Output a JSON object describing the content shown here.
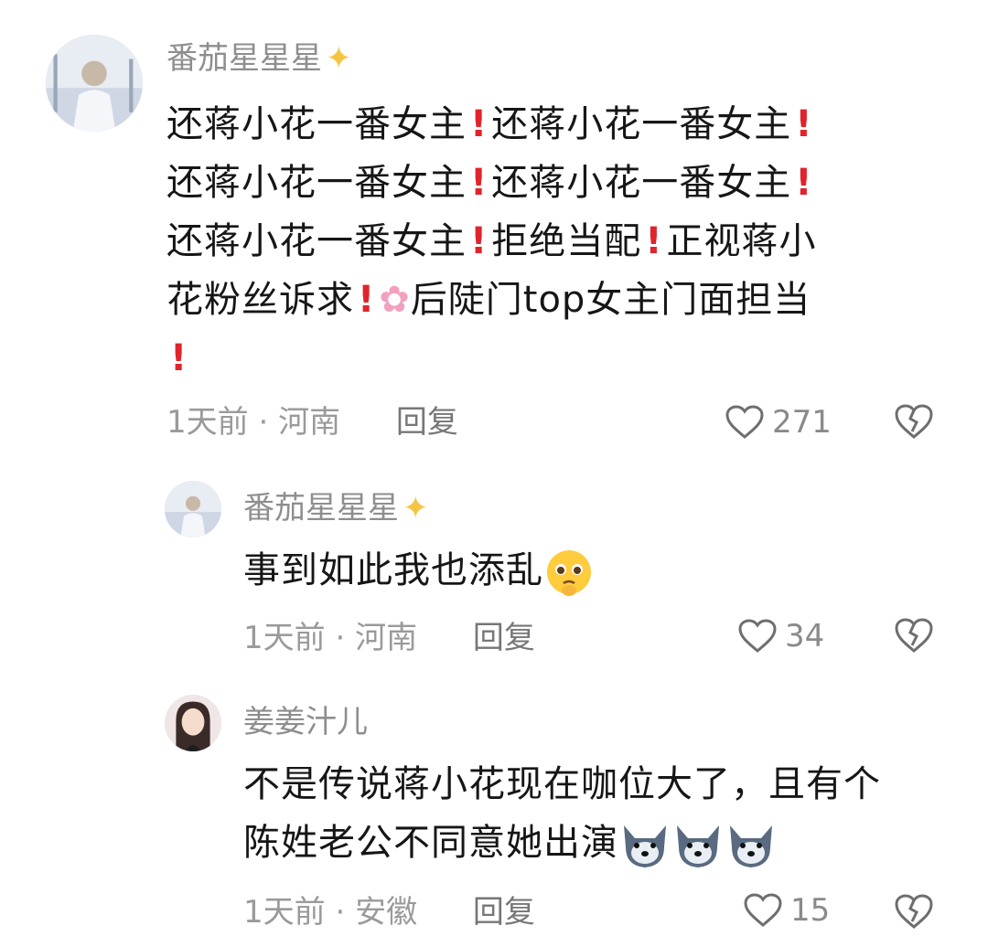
{
  "comments": [
    {
      "user": "番茄星星星",
      "lines": [
        "还蒋小花一番女主",
        "还蒋小花一番女主",
        "还蒋小花一番女主",
        "还蒋小花一番女主",
        "还蒋小花一番女主",
        "拒绝当配",
        "正视蒋小",
        "花粉丝诉求",
        "后陡门top女主门面担当"
      ],
      "time": "1天前",
      "location": "河南",
      "reply_label": "回复",
      "likes": "271"
    },
    {
      "user": "番茄星星星",
      "text": "事到如此我也添乱",
      "time": "1天前",
      "location": "河南",
      "reply_label": "回复",
      "likes": "34"
    },
    {
      "user": "姜姜汁儿",
      "line1": "不是传说蒋小花现在咖位大了，且有个",
      "line2": "陈姓老公不同意她出演",
      "time": "1天前",
      "location": "安徽",
      "reply_label": "回复",
      "likes": "15"
    }
  ],
  "separator": "·",
  "icons": [
    "sparkle-icon",
    "exclamation-icon",
    "cherry-blossom-icon",
    "pleading-face-icon",
    "husky-face-icon",
    "heart-icon",
    "broken-heart-icon"
  ],
  "colors": {
    "exclamation": "#e0242b",
    "muted": "#8e8e8e",
    "text": "#161616"
  }
}
